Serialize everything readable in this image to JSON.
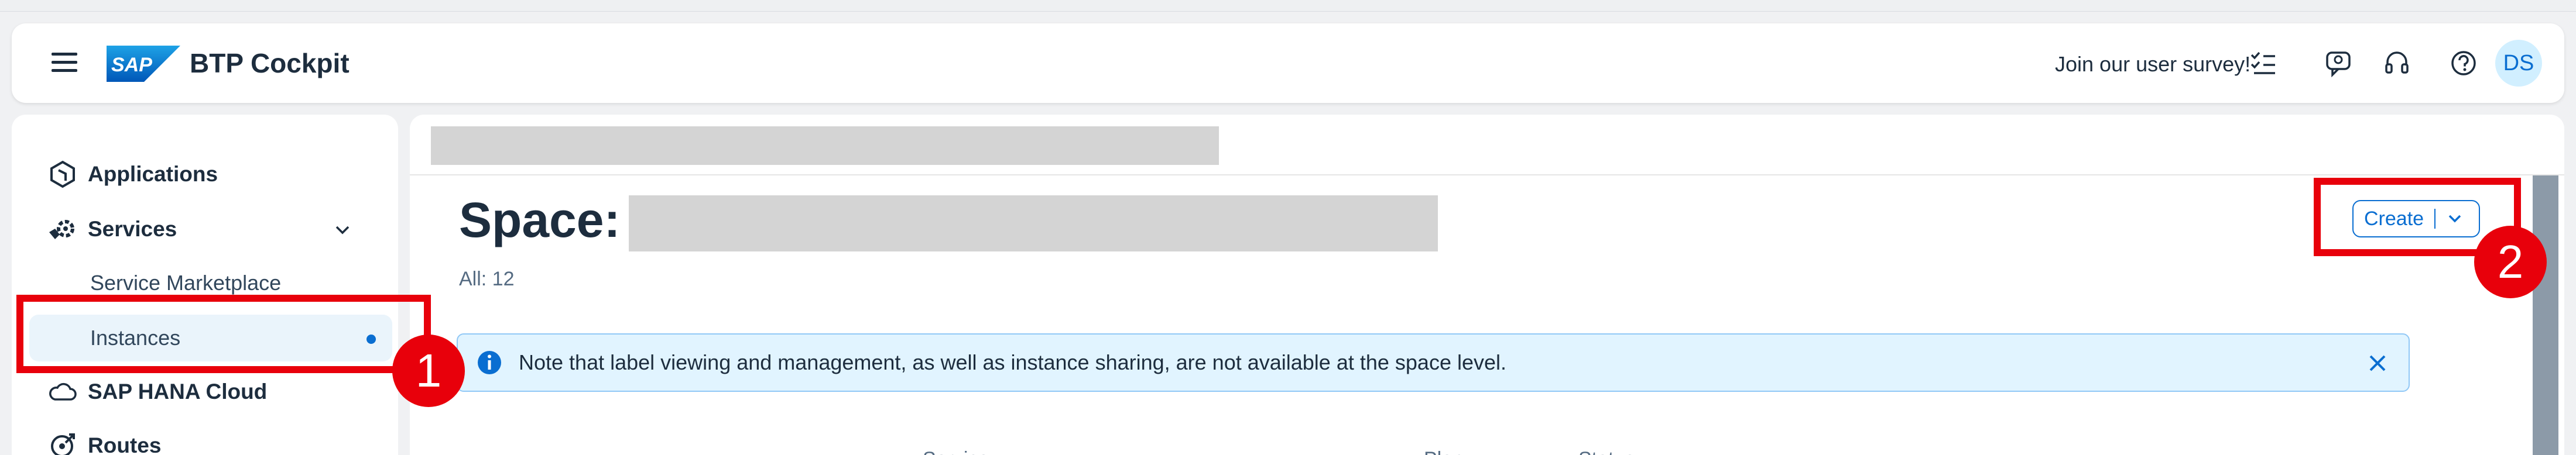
{
  "shellbar": {
    "brand_logo_text": "SAP",
    "title": "BTP Cockpit",
    "survey_label": "Join our user survey!",
    "avatar_initials": "DS"
  },
  "sidebar": {
    "items": [
      {
        "label": "Applications",
        "icon": "applications-icon"
      },
      {
        "label": "Services",
        "icon": "services-icon",
        "expanded": true
      },
      {
        "label": "Service Marketplace",
        "sub": true
      },
      {
        "label": "Instances",
        "sub": true,
        "selected": true
      },
      {
        "label": "SAP HANA Cloud",
        "icon": "cloud-icon"
      },
      {
        "label": "Routes",
        "icon": "routes-icon"
      }
    ]
  },
  "main": {
    "title_prefix": "Space:",
    "count_label": "All: 12",
    "create_button": "Create",
    "info_message": "Note that label viewing and management, as well as instance sharing, are not available at the space level.",
    "columns": [
      "Service",
      "Plan",
      "Status"
    ]
  },
  "annotations": {
    "badge_1": "1",
    "badge_2": "2"
  },
  "colors": {
    "accent": "#0a6ed1",
    "highlight": "#e8000b",
    "info_bg": "#e1f4ff"
  }
}
